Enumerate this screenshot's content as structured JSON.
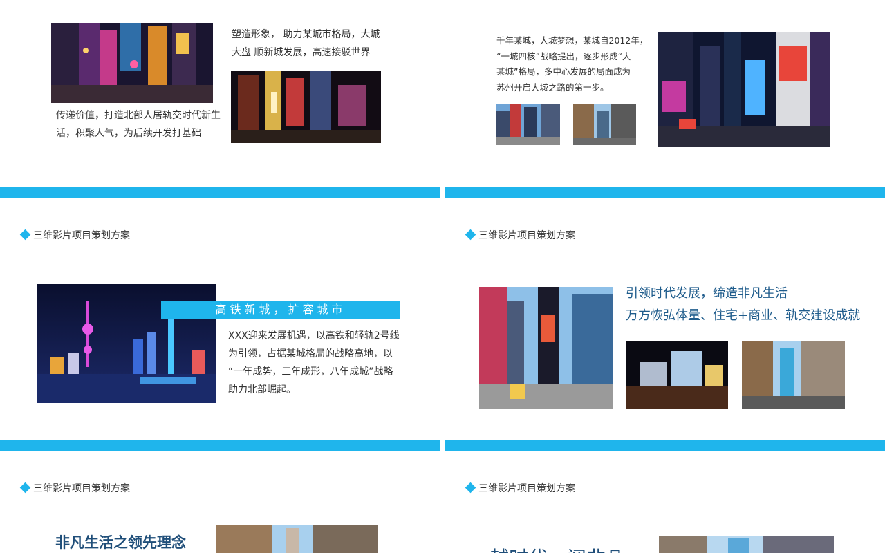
{
  "slides": {
    "top_left": {
      "paragraph_a": [
        "塑造形象， 助力某城市格局，大城",
        "大盘 顺新城发展，高速接驳世界"
      ],
      "paragraph_b": [
        "传递价值，打造北部人居轨交时代新生",
        "活，积聚人气，为后续开发打基础"
      ]
    },
    "top_right": {
      "paragraph": [
        "千年某城，大城梦想，某城自2012年，",
        "“一城四核”战略提出，逐步形成“大",
        "某城”格局，多中心发展的局面成为",
        "苏州开启大城之路的第一步。"
      ]
    },
    "mid_left": {
      "header": "三维影片项目策划方案",
      "banner": "高铁新城，扩容城市",
      "paragraph": [
        "XXX迎来发展机遇，以高铁和轻轨2号线",
        "为引领，占据某城格局的战略高地，以",
        "“一年成势，三年成形，八年成城”战略",
        "助力北部崛起。"
      ]
    },
    "mid_right": {
      "header": "三维影片项目策划方案",
      "heading_lines": [
        "引领时代发展，缔造非凡生活",
        "万方恢弘体量、住宅+商业、轨交建设成就"
      ]
    },
    "bottom_left": {
      "header": "三维影片项目策划方案",
      "title": "非凡生活之领先理念"
    },
    "bottom_right": {
      "header": "三维影片项目策划方案",
      "title": "越时代，阅非凡"
    }
  },
  "colors": {
    "accent": "#1fb5ec",
    "title_blue": "#1f4e79",
    "heading_blue": "#1f5c8c",
    "rule": "#8aa0b4"
  }
}
